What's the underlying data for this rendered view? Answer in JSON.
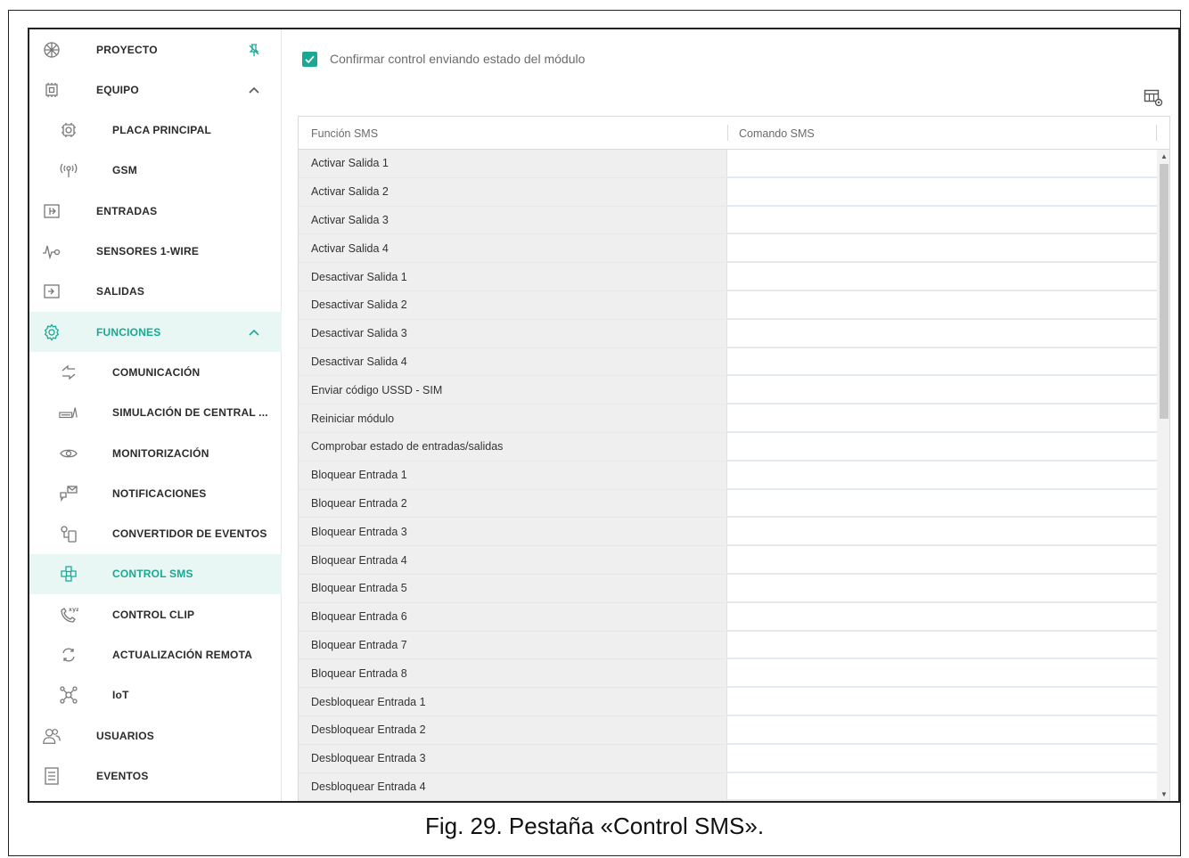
{
  "sidebar": {
    "items": [
      {
        "label": "PROYECTO",
        "icon": "project-icon",
        "level": 1,
        "trail": "pin-icon"
      },
      {
        "label": "EQUIPO",
        "icon": "chip-icon",
        "level": 1,
        "trail": "chevron-up-icon"
      },
      {
        "label": "PLACA PRINCIPAL",
        "icon": "board-icon",
        "level": 2
      },
      {
        "label": "GSM",
        "icon": "antenna-icon",
        "level": 2
      },
      {
        "label": "ENTRADAS",
        "icon": "input-icon",
        "level": 1
      },
      {
        "label": "SENSORES 1-WIRE",
        "icon": "sensor-icon",
        "level": 1
      },
      {
        "label": "SALIDAS",
        "icon": "output-icon",
        "level": 1
      },
      {
        "label": "FUNCIONES",
        "icon": "gear-icon",
        "level": 1,
        "trail": "chevron-up-icon",
        "state": "expanded"
      },
      {
        "label": "COMUNICACIÓN",
        "icon": "communication-icon",
        "level": 2
      },
      {
        "label": "SIMULACIÓN DE CENTRAL ...",
        "icon": "panel-simulation-icon",
        "level": 2
      },
      {
        "label": "MONITORIZACIÓN",
        "icon": "eye-icon",
        "level": 2
      },
      {
        "label": "NOTIFICACIONES",
        "icon": "notification-icon",
        "level": 2
      },
      {
        "label": "CONVERTIDOR DE EVENTOS",
        "icon": "event-converter-icon",
        "level": 2
      },
      {
        "label": "CONTROL SMS",
        "icon": "sms-control-icon",
        "level": 2,
        "state": "selected"
      },
      {
        "label": "CONTROL CLIP",
        "icon": "clip-phone-icon",
        "level": 2
      },
      {
        "label": "ACTUALIZACIÓN REMOTA",
        "icon": "refresh-icon",
        "level": 2
      },
      {
        "label": "IoT",
        "icon": "iot-icon",
        "level": 2
      },
      {
        "label": "USUARIOS",
        "icon": "users-icon",
        "level": 1
      },
      {
        "label": "EVENTOS",
        "icon": "document-icon",
        "level": 1
      }
    ]
  },
  "main": {
    "confirm_label": "Confirmar control enviando estado del módulo",
    "confirm_checked": true,
    "table": {
      "columns": [
        "Función SMS",
        "Comando SMS"
      ],
      "rows": [
        "Activar Salida 1",
        "Activar Salida 2",
        "Activar Salida 3",
        "Activar Salida 4",
        "Desactivar Salida 1",
        "Desactivar Salida 2",
        "Desactivar Salida 3",
        "Desactivar Salida 4",
        "Enviar código USSD - SIM",
        "Reiniciar módulo",
        "Comprobar estado de entradas/salidas",
        "Bloquear Entrada 1",
        "Bloquear Entrada 2",
        "Bloquear Entrada 3",
        "Bloquear Entrada 4",
        "Bloquear Entrada 5",
        "Bloquear Entrada 6",
        "Bloquear Entrada 7",
        "Bloquear Entrada 8",
        "Desbloquear Entrada 1",
        "Desbloquear Entrada 2",
        "Desbloquear Entrada 3",
        "Desbloquear Entrada 4"
      ]
    }
  },
  "caption": "Fig. 29. Pestaña «Control SMS».",
  "colors": {
    "accent": "#1ba892",
    "active_bg": "#e8f6f4",
    "func_cell_bg": "#efefef"
  }
}
